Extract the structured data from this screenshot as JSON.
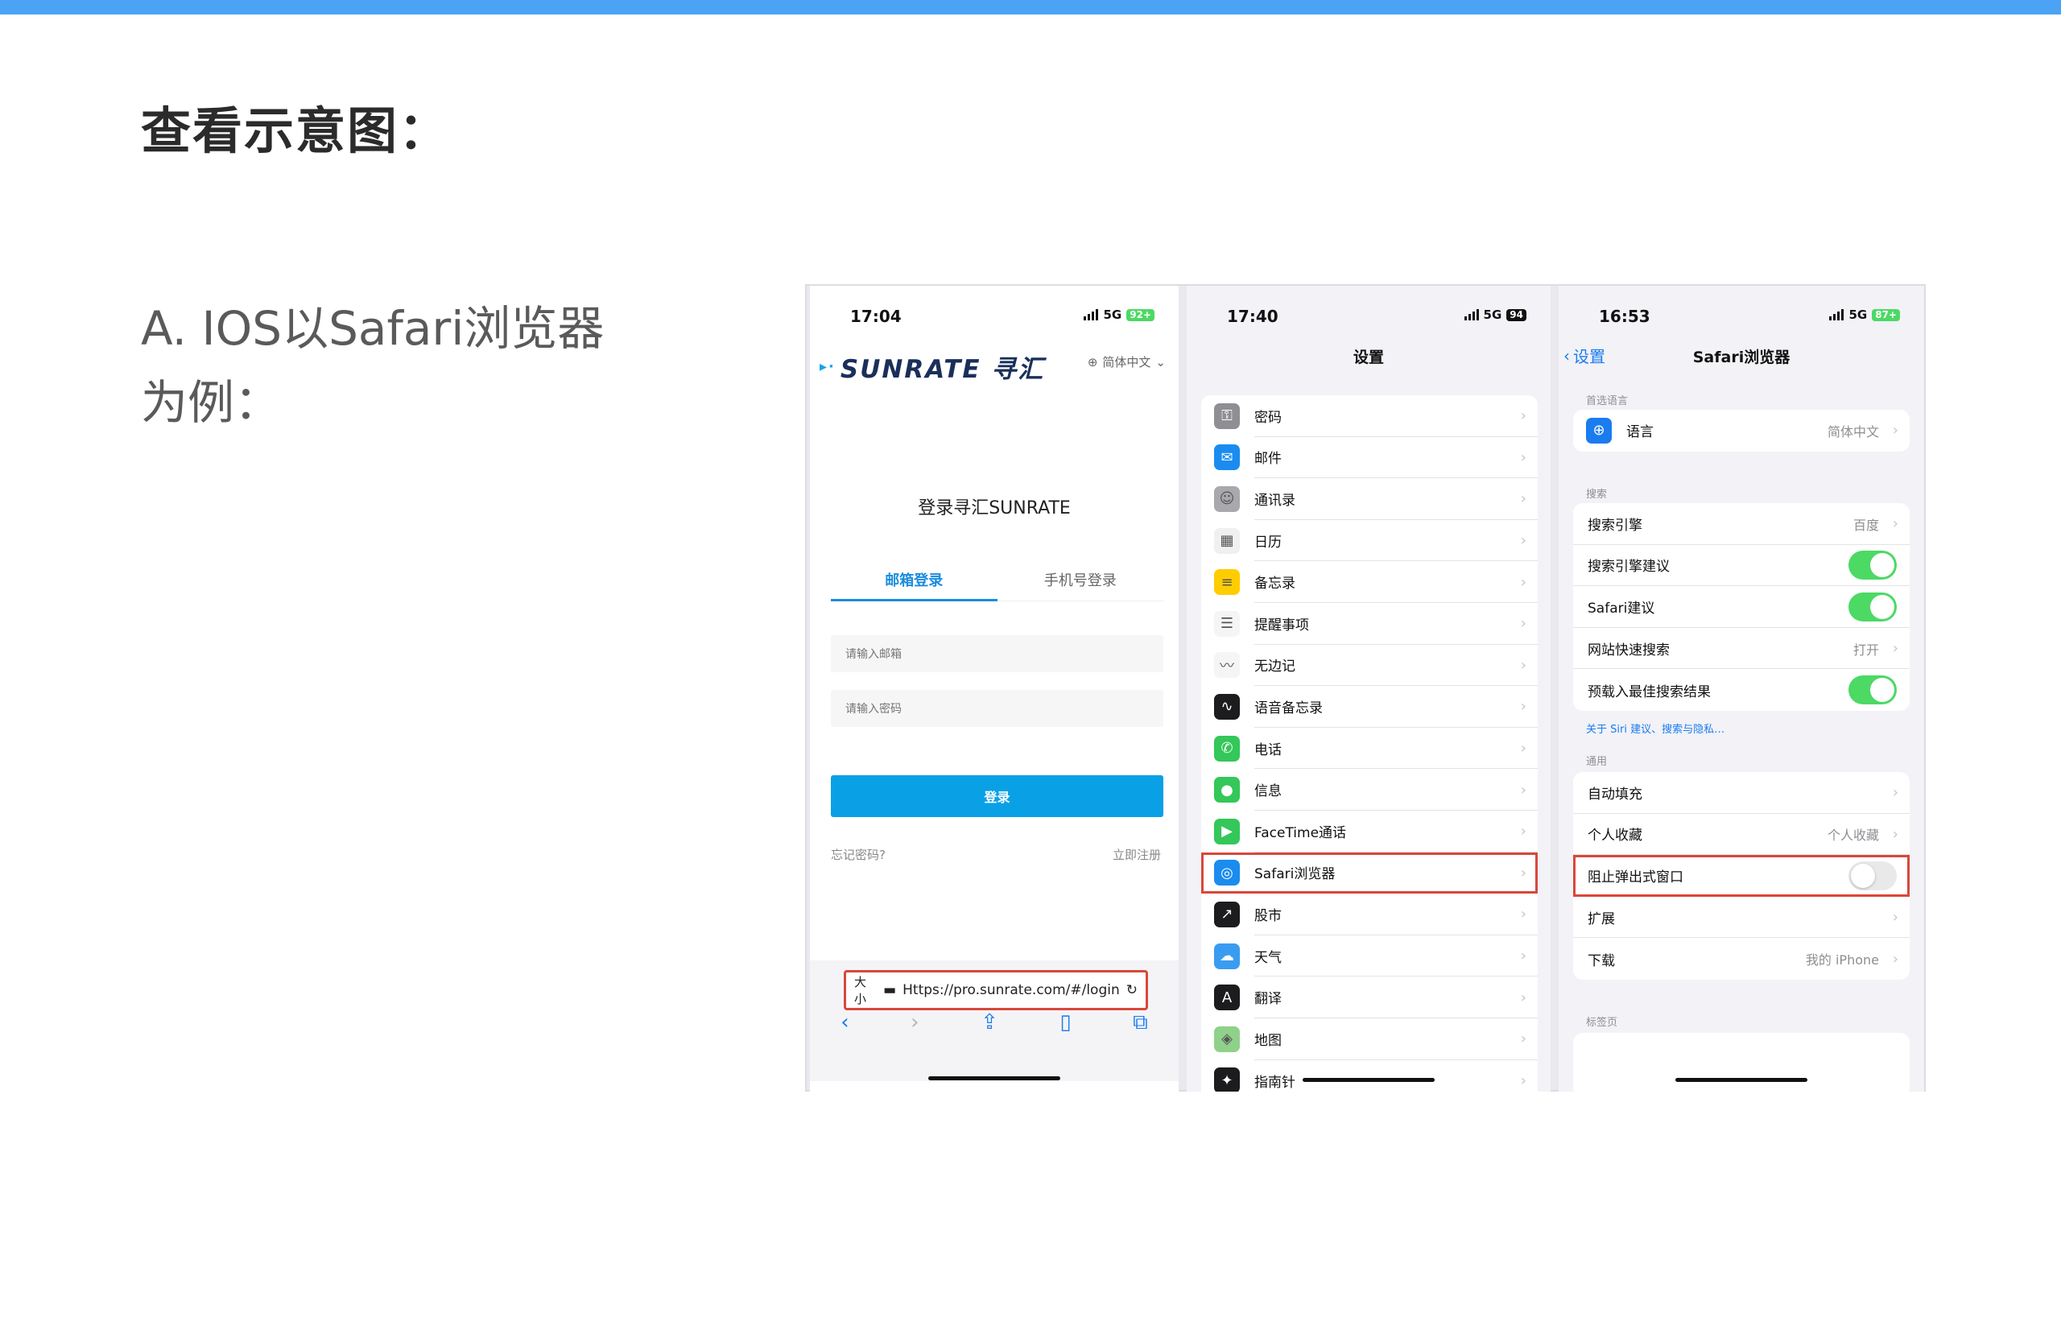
{
  "heading": "查看示意图：",
  "intro": {
    "line1": "A. IOS以Safari浏览器",
    "line2": "为例："
  },
  "phone1": {
    "time": "17:04",
    "network": "5G",
    "battery": "92+",
    "logo": "SUNRATE 寻汇",
    "language": "简体中文",
    "title": "登录寻汇SUNRATE",
    "tabs": [
      "邮箱登录",
      "手机号登录"
    ],
    "email_placeholder": "请输入邮箱",
    "password_placeholder": "请输入密码",
    "login_button": "登录",
    "forgot": "忘记密码?",
    "register": "立即注册",
    "url_aa": "大小",
    "url": "Https://pro.sunrate.com/#/login"
  },
  "phone2": {
    "time": "17:40",
    "network": "5G",
    "battery": "94",
    "title": "设置",
    "items": [
      {
        "label": "密码",
        "icon": "key-icon",
        "color": "#8e8e93"
      },
      {
        "label": "邮件",
        "icon": "mail-icon",
        "color": "#1a8cf0"
      },
      {
        "label": "通讯录",
        "icon": "contacts-icon",
        "color": "#a8a8ad"
      },
      {
        "label": "日历",
        "icon": "calendar-icon",
        "color": "#f0f0f0"
      },
      {
        "label": "备忘录",
        "icon": "notes-icon",
        "color": "#ffcc00"
      },
      {
        "label": "提醒事项",
        "icon": "reminders-icon",
        "color": "#f5f5f5"
      },
      {
        "label": "无边记",
        "icon": "freeform-icon",
        "color": "#f5f5f5"
      },
      {
        "label": "语音备忘录",
        "icon": "voice-memo-icon",
        "color": "#1c1c1e"
      },
      {
        "label": "电话",
        "icon": "phone-icon",
        "color": "#34c759"
      },
      {
        "label": "信息",
        "icon": "messages-icon",
        "color": "#34c759"
      },
      {
        "label": "FaceTime通话",
        "icon": "facetime-icon",
        "color": "#34c759"
      },
      {
        "label": "Safari浏览器",
        "icon": "safari-icon",
        "color": "#1a8cf0"
      },
      {
        "label": "股市",
        "icon": "stocks-icon",
        "color": "#1c1c1e"
      },
      {
        "label": "天气",
        "icon": "weather-icon",
        "color": "#3a9cf0"
      },
      {
        "label": "翻译",
        "icon": "translate-icon",
        "color": "#1c1c1e"
      },
      {
        "label": "地图",
        "icon": "maps-icon",
        "color": "#8fd18a"
      },
      {
        "label": "指南针",
        "icon": "compass-icon",
        "color": "#1c1c1e"
      }
    ]
  },
  "phone3": {
    "time": "16:53",
    "network": "5G",
    "battery": "87+",
    "back": "设置",
    "title": "Safari浏览器",
    "sections": {
      "preferred_language": "首选语言",
      "search": "搜索",
      "general": "通用",
      "tabs": "标签页"
    },
    "language": {
      "label": "语言",
      "value": "简体中文"
    },
    "search_engine": {
      "label": "搜索引擎",
      "value": "百度"
    },
    "search_suggestions": {
      "label": "搜索引擎建议",
      "on": true
    },
    "safari_suggestions": {
      "label": "Safari建议",
      "on": true
    },
    "quick_website_search": {
      "label": "网站快速搜索",
      "value": "打开"
    },
    "preload_top_hit": {
      "label": "预载入最佳搜索结果",
      "on": true
    },
    "siri_link": "关于 Siri 建议、搜索与隐私…",
    "autofill": {
      "label": "自动填充"
    },
    "favorites": {
      "label": "个人收藏",
      "value": "个人收藏"
    },
    "block_popups": {
      "label": "阻止弹出式窗口",
      "on": false
    },
    "extensions": {
      "label": "扩展"
    },
    "downloads": {
      "label": "下载",
      "value": "我的 iPhone"
    }
  }
}
